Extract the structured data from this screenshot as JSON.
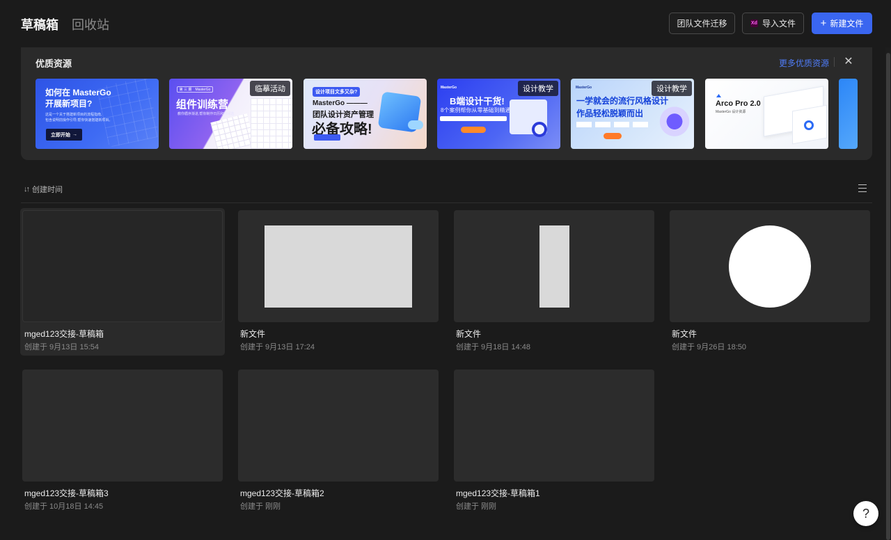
{
  "header": {
    "tab_drafts": "草稿箱",
    "tab_trash": "回收站",
    "btn_migrate": "团队文件迁移",
    "btn_import": "导入文件",
    "btn_import_icon": "Xd",
    "btn_new": "新建文件",
    "btn_new_icon": "+"
  },
  "resources": {
    "title": "优质资源",
    "more_link": "更多优质资源",
    "close_icon": "✕",
    "cards": [
      {
        "line1": "如何在 MasterGo",
        "line2": "开展新项目?",
        "desc1": "这是一个关于搭建新项目的流程指南,",
        "desc2": "包含说明前操作引导,帮你快速搭建新项目。",
        "button": "立即开始",
        "tag": ""
      },
      {
        "pill_a": "第 三 期",
        "pill_b": "MasterGo",
        "title": "组件训练营",
        "desc": "教你循序渐进,帮你制作日历和时间选",
        "tag": "临摹活动"
      },
      {
        "badge": "设计项目文多又杂?",
        "line1": "MasterGo ———",
        "line2": "团队设计资产管理",
        "line3": "必备攻略!",
        "tag": ""
      },
      {
        "logo": "MasterGo",
        "title": "B端设计干货!",
        "desc": "8个案例帮你从零基础到精通!",
        "tag": "设计教学"
      },
      {
        "logo": "MasterGo",
        "line1": "一学就会的流行风格设计",
        "line2": "作品轻松脱颖而出",
        "tag": "设计教学"
      },
      {
        "title": "Arco Pro 2.0",
        "desc": "MasterGo 设计资源",
        "tag": ""
      }
    ]
  },
  "sort": {
    "label": "创建时间",
    "icon": "↓↑"
  },
  "files": [
    {
      "name": "mged123交接-草稿箱",
      "date": "创建于 9月13日 15:54"
    },
    {
      "name": "新文件",
      "date": "创建于 9月13日 17:24"
    },
    {
      "name": "新文件",
      "date": "创建于 9月18日 14:48"
    },
    {
      "name": "新文件",
      "date": "创建于 9月26日 18:50"
    },
    {
      "name": "mged123交接-草稿箱3",
      "date": "创建于 10月18日 14:45"
    },
    {
      "name": "mged123交接-草稿箱2",
      "date": "创建于 刚刚"
    },
    {
      "name": "mged123交接-草稿箱1",
      "date": "创建于 刚刚"
    }
  ],
  "help": {
    "icon": "?"
  },
  "colors": {
    "accent": "#3a66f0",
    "link": "#4f7cf7",
    "background": "#1b1b1b"
  }
}
